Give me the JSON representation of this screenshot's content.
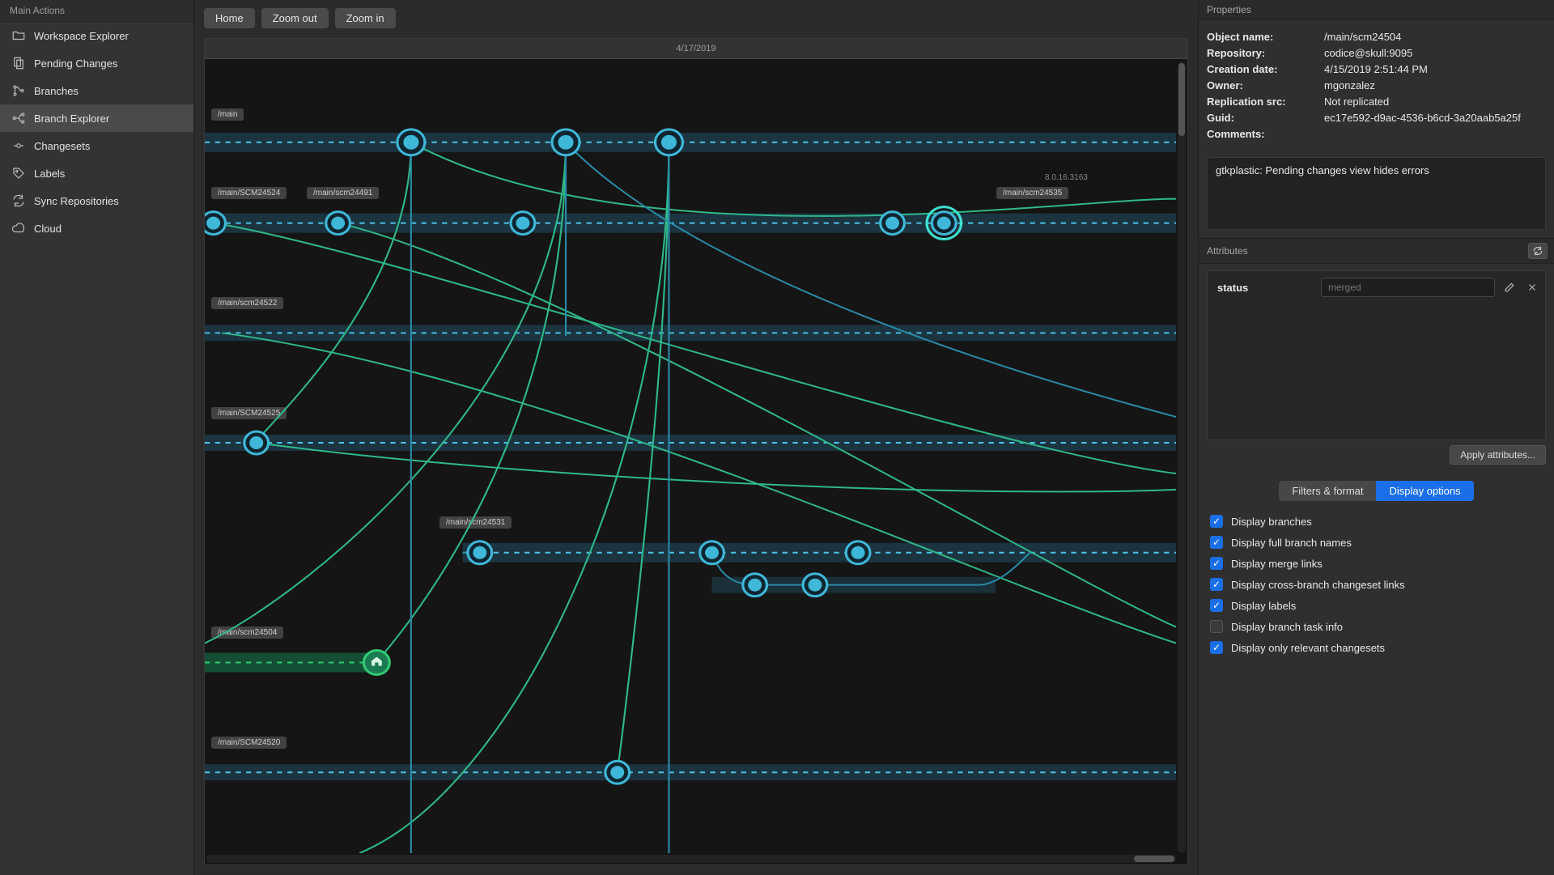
{
  "sidebar": {
    "header": "Main Actions",
    "items": [
      {
        "label": "Workspace Explorer",
        "icon": "folder"
      },
      {
        "label": "Pending Changes",
        "icon": "files"
      },
      {
        "label": "Branches",
        "icon": "branches"
      },
      {
        "label": "Branch Explorer",
        "icon": "branch-explorer",
        "active": true
      },
      {
        "label": "Changesets",
        "icon": "changesets"
      },
      {
        "label": "Labels",
        "icon": "labels"
      },
      {
        "label": "Sync Repositories",
        "icon": "sync"
      },
      {
        "label": "Cloud",
        "icon": "cloud"
      }
    ]
  },
  "toolbar": {
    "home": "Home",
    "zoom_out": "Zoom out",
    "zoom_in": "Zoom in"
  },
  "graph": {
    "date_header": "4/17/2019",
    "version_tag": "8.0.16.3163",
    "branch_labels": {
      "main": "/main",
      "scm24524": "/main/SCM24524",
      "scm24491": "/main/scm24491",
      "scm24535": "/main/scm24535",
      "scm24522": "/main/scm24522",
      "scm24525": "/main/SCM24525",
      "scm24531": "/main/scm24531",
      "scm24504": "/main/scm24504",
      "scm24520": "/main/SCM24520"
    }
  },
  "properties": {
    "header": "Properties",
    "rows": {
      "object_name_label": "Object name:",
      "object_name_value": "/main/scm24504",
      "repository_label": "Repository:",
      "repository_value": "codice@skull:9095",
      "creation_date_label": "Creation date:",
      "creation_date_value": "4/15/2019 2:51:44 PM",
      "owner_label": "Owner:",
      "owner_value": "mgonzalez",
      "replication_label": "Replication src:",
      "replication_value": "Not replicated",
      "guid_label": "Guid:",
      "guid_value": "ec17e592-d9ac-4536-b6cd-3a20aab5a25f",
      "comments_label": "Comments:"
    },
    "comments_text": "gtkplastic: Pending changes view hides errors"
  },
  "attributes": {
    "header": "Attributes",
    "rows": [
      {
        "key": "status",
        "value": "merged"
      }
    ],
    "apply_label": "Apply attributes..."
  },
  "tabs": {
    "filters": "Filters & format",
    "display": "Display options"
  },
  "display_options": [
    {
      "label": "Display branches",
      "checked": true
    },
    {
      "label": "Display full branch names",
      "checked": true
    },
    {
      "label": "Display merge links",
      "checked": true
    },
    {
      "label": "Display cross-branch changeset links",
      "checked": true
    },
    {
      "label": "Display labels",
      "checked": true
    },
    {
      "label": "Display branch task info",
      "checked": false
    },
    {
      "label": "Display only relevant changesets",
      "checked": true
    }
  ]
}
